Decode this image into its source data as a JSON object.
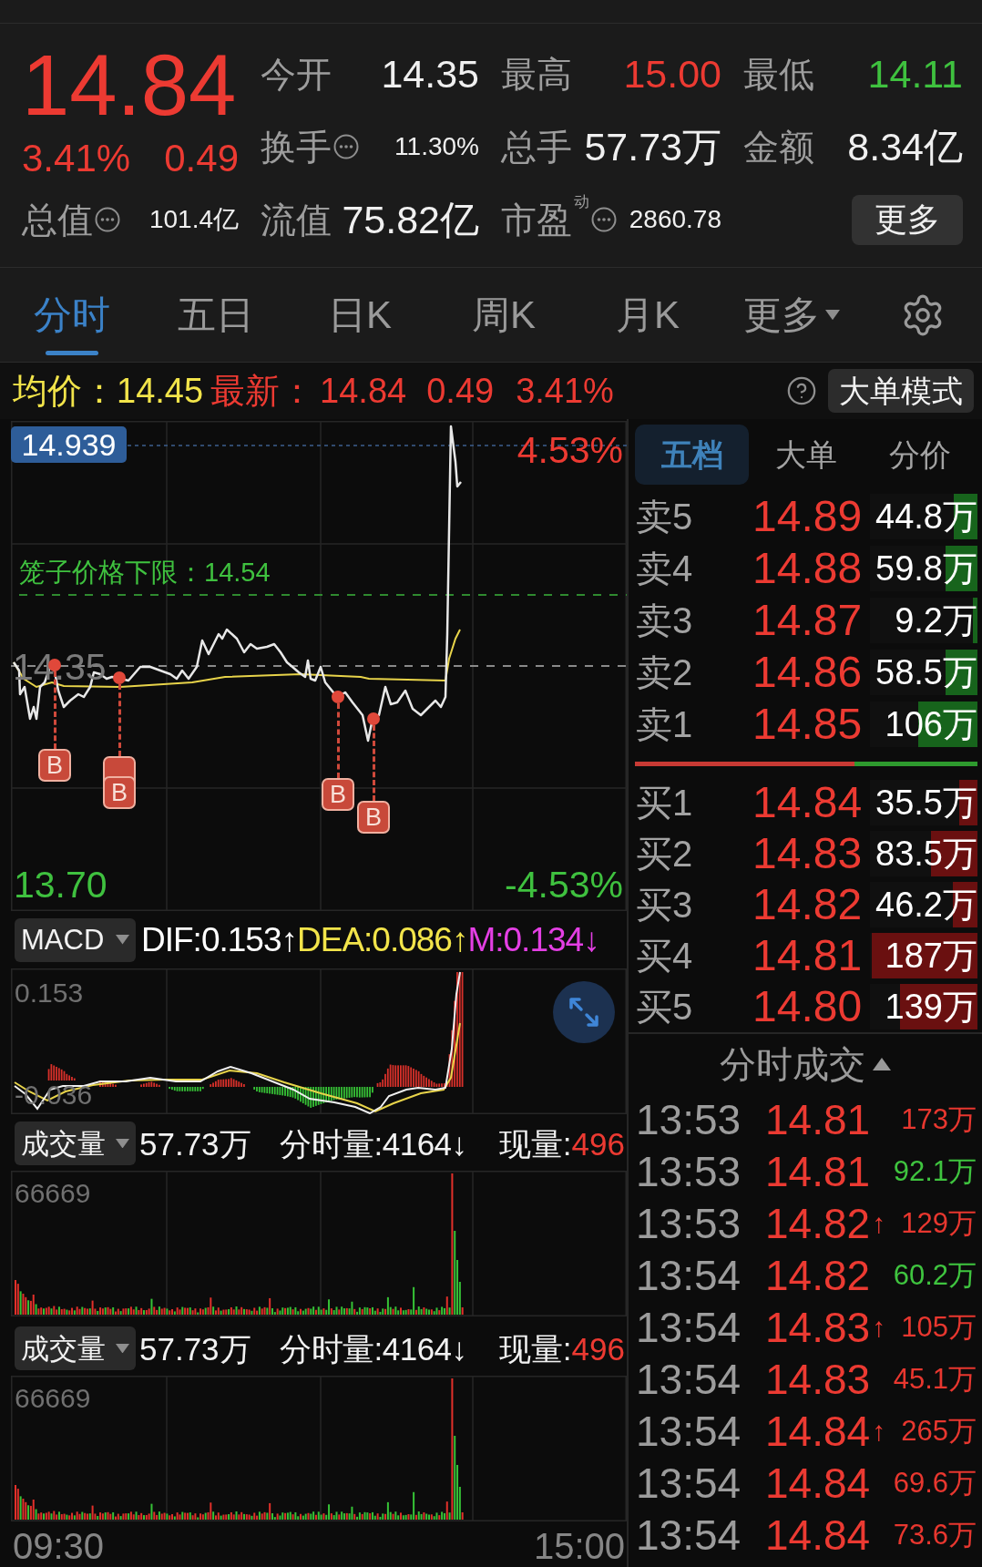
{
  "quote": {
    "price": "14.84",
    "change_pct": "3.41%",
    "change": "0.49",
    "stats": [
      {
        "label": "今开",
        "value": "14.35",
        "color": "#f0f0f0",
        "info": false
      },
      {
        "label": "最高",
        "value": "15.00",
        "color": "#ec3a32",
        "info": false
      },
      {
        "label": "最低",
        "value": "14.11",
        "color": "#3fc13f",
        "info": false
      },
      {
        "label": "换手",
        "value": "11.30%",
        "color": "#f0f0f0",
        "info": true
      },
      {
        "label": "总手",
        "value": "57.73万",
        "color": "#f0f0f0",
        "info": false
      },
      {
        "label": "金额",
        "value": "8.34亿",
        "color": "#f0f0f0",
        "info": false
      },
      {
        "label": "总值",
        "value": "101.4亿",
        "color": "#f0f0f0",
        "info": true
      },
      {
        "label": "流值",
        "value": "75.82亿",
        "color": "#f0f0f0",
        "info": false
      },
      {
        "label": "市盈",
        "note": "动",
        "value": "2860.78",
        "color": "#f0f0f0",
        "info": true
      }
    ],
    "more_button": "更多"
  },
  "chart_tabs": [
    {
      "label": "分时",
      "kind": "tab",
      "selected": true
    },
    {
      "label": "五日",
      "kind": "tab",
      "selected": false
    },
    {
      "label": "日K",
      "kind": "tab",
      "selected": false
    },
    {
      "label": "周K",
      "kind": "tab",
      "selected": false
    },
    {
      "label": "月K",
      "kind": "tab",
      "selected": false
    },
    {
      "label": "更多",
      "kind": "menu",
      "selected": false
    }
  ],
  "summary": {
    "avg_label": "均价：",
    "avg_value": "14.45",
    "latest_label": "最新：",
    "latest_price": "14.84",
    "latest_change": "0.49",
    "latest_pct": "3.41%",
    "mode_button": "大单模式"
  },
  "intraday_chart": {
    "cursor_price": "14.939",
    "upper_pct": "4.53%",
    "cage_limit": "笼子价格下限：14.54",
    "prev_close": "14.35",
    "low_price": "13.70",
    "lower_pct": "-4.53%",
    "markers": [
      {
        "label": "B",
        "stacked": false
      },
      {
        "label": "B",
        "stacked": true
      },
      {
        "label": "B",
        "stacked": false
      },
      {
        "label": "B",
        "stacked": false
      }
    ]
  },
  "macd": {
    "selector": "MACD",
    "readings": [
      {
        "text": "DIF:0.153↑",
        "color": "#ffffff"
      },
      {
        "text": "DEA:0.086↑",
        "color": "#f2e44a"
      },
      {
        "text": "M:0.134↓",
        "color": "#e43fe4"
      }
    ],
    "top_label": "0.153",
    "bottom_label": "-0.036"
  },
  "volume_panels": [
    {
      "selector": "成交量",
      "total": "57.73万",
      "minute_volume": "分时量:4164↓",
      "current_label": "现量:",
      "current_value": "496",
      "scale_label": "66669"
    },
    {
      "selector": "成交量",
      "total": "57.73万",
      "minute_volume": "分时量:4164↓",
      "current_label": "现量:",
      "current_value": "496",
      "scale_label": "66669"
    }
  ],
  "time_axis": [
    "09:30",
    "15:00"
  ],
  "order_book": {
    "tabs": [
      {
        "label": "五档",
        "selected": true
      },
      {
        "label": "大单",
        "selected": false
      },
      {
        "label": "分价",
        "selected": false
      }
    ],
    "asks": [
      {
        "label": "卖5",
        "price": "14.89",
        "volume": "44.8万",
        "level": 0.22
      },
      {
        "label": "卖4",
        "price": "14.88",
        "volume": "59.8万",
        "level": 0.3
      },
      {
        "label": "卖3",
        "price": "14.87",
        "volume": "9.2万",
        "level": 0.04
      },
      {
        "label": "卖2",
        "price": "14.86",
        "volume": "58.5万",
        "level": 0.3
      },
      {
        "label": "卖1",
        "price": "14.85",
        "volume": "106万",
        "level": 0.55
      }
    ],
    "ratio": {
      "level": 0.64
    },
    "bids": [
      {
        "label": "买1",
        "price": "14.84",
        "volume": "35.5万",
        "level": 0.17
      },
      {
        "label": "买2",
        "price": "14.83",
        "volume": "83.5万",
        "level": 0.43
      },
      {
        "label": "买3",
        "price": "14.82",
        "volume": "46.2万",
        "level": 0.23
      },
      {
        "label": "买4",
        "price": "14.81",
        "volume": "187万",
        "level": 0.98
      },
      {
        "label": "买5",
        "price": "14.80",
        "volume": "139万",
        "level": 0.72
      }
    ]
  },
  "trades": {
    "title": "分时成交",
    "rows": [
      {
        "time": "13:53",
        "price": "14.81",
        "volume": "173万",
        "color": "#e8372f"
      },
      {
        "time": "13:53",
        "price": "14.81",
        "volume": "92.1万",
        "color": "#3fc43f"
      },
      {
        "time": "13:53",
        "price": "14.82",
        "arrow": "↑",
        "volume": "129万",
        "color": "#e8372f"
      },
      {
        "time": "13:54",
        "price": "14.82",
        "volume": "60.2万",
        "color": "#3fc43f"
      },
      {
        "time": "13:54",
        "price": "14.83",
        "arrow": "↑",
        "volume": "105万",
        "color": "#e8372f"
      },
      {
        "time": "13:54",
        "price": "14.83",
        "volume": "45.1万",
        "color": "#e8372f"
      },
      {
        "time": "13:54",
        "price": "14.84",
        "arrow": "↑",
        "volume": "265万",
        "color": "#e8372f"
      },
      {
        "time": "13:54",
        "price": "14.84",
        "volume": "69.6万",
        "color": "#e8372f"
      },
      {
        "time": "13:54",
        "price": "14.84",
        "volume": "73.6万",
        "color": "#e8372f"
      }
    ]
  }
}
